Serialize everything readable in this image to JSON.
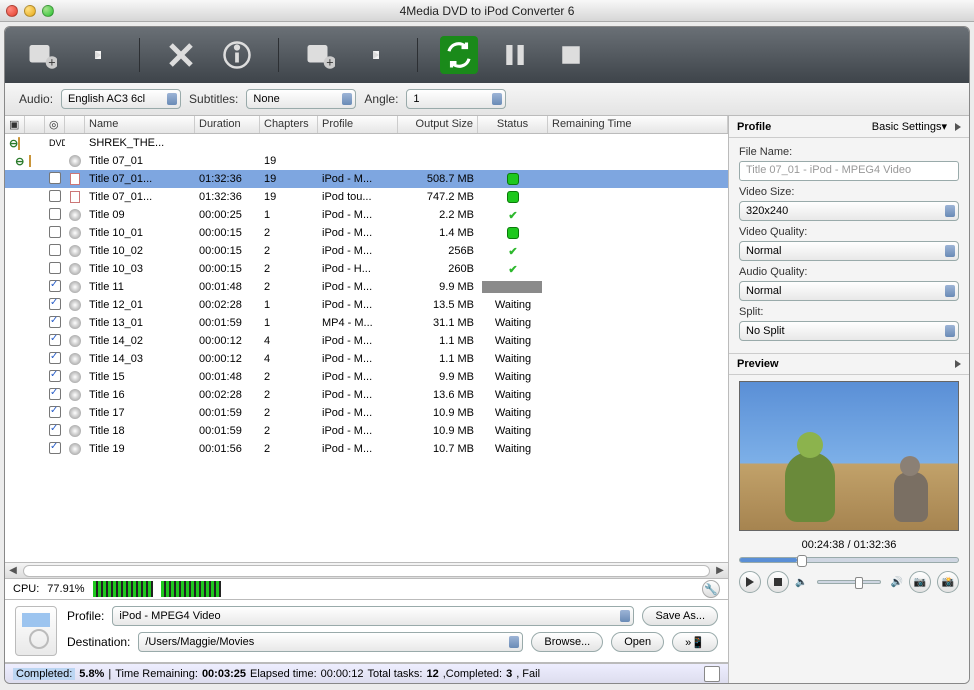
{
  "app": {
    "title": "4Media DVD to iPod Converter 6"
  },
  "selectors": {
    "audio_label": "Audio:",
    "audio_value": "English AC3 6cl",
    "subtitles_label": "Subtitles:",
    "subtitles_value": "None",
    "angle_label": "Angle:",
    "angle_value": "1"
  },
  "columns": {
    "name": "Name",
    "duration": "Duration",
    "chapters": "Chapters",
    "profile": "Profile",
    "output": "Output Size",
    "status": "Status",
    "remaining": "Remaining Time"
  },
  "rows": [
    {
      "tree": "root",
      "icon": "dvd",
      "name": "SHREK_THE...",
      "dur": "",
      "chap": "",
      "prof": "",
      "out": "",
      "stat": ""
    },
    {
      "tree": "folder",
      "icon": "disc",
      "name": "Title 07_01",
      "dur": "",
      "chap": "19",
      "prof": "",
      "out": "",
      "stat": ""
    },
    {
      "tree": "item",
      "sel": true,
      "chk": false,
      "icon": "file",
      "name": "Title 07_01...",
      "dur": "01:32:36",
      "chap": "19",
      "prof": "iPod - M...",
      "out": "508.7 MB",
      "stat": "green"
    },
    {
      "tree": "item",
      "chk": false,
      "icon": "file",
      "name": "Title 07_01...",
      "dur": "01:32:36",
      "chap": "19",
      "prof": "iPod tou...",
      "out": "747.2 MB",
      "stat": "green"
    },
    {
      "tree": "item",
      "chk": false,
      "icon": "disc",
      "name": "Title 09",
      "dur": "00:00:25",
      "chap": "1",
      "prof": "iPod - M...",
      "out": "2.2 MB",
      "stat": "check"
    },
    {
      "tree": "item",
      "chk": false,
      "icon": "disc",
      "name": "Title 10_01",
      "dur": "00:00:15",
      "chap": "2",
      "prof": "iPod - M...",
      "out": "1.4 MB",
      "stat": "green"
    },
    {
      "tree": "item",
      "chk": false,
      "icon": "disc",
      "name": "Title 10_02",
      "dur": "00:00:15",
      "chap": "2",
      "prof": "iPod - M...",
      "out": "256B",
      "stat": "check"
    },
    {
      "tree": "item",
      "chk": false,
      "icon": "disc",
      "name": "Title 10_03",
      "dur": "00:00:15",
      "chap": "2",
      "prof": "iPod - H...",
      "out": "260B",
      "stat": "check"
    },
    {
      "tree": "item",
      "chk": true,
      "icon": "disc",
      "name": "Title 11",
      "dur": "00:01:48",
      "chap": "2",
      "prof": "iPod - M...",
      "out": "9.9 MB",
      "stat": "prog"
    },
    {
      "tree": "item",
      "chk": true,
      "icon": "disc",
      "name": "Title 12_01",
      "dur": "00:02:28",
      "chap": "1",
      "prof": "iPod - M...",
      "out": "13.5 MB",
      "stat": "Waiting"
    },
    {
      "tree": "item",
      "chk": true,
      "icon": "disc",
      "name": "Title 13_01",
      "dur": "00:01:59",
      "chap": "1",
      "prof": "MP4 - M...",
      "out": "31.1 MB",
      "stat": "Waiting"
    },
    {
      "tree": "item",
      "chk": true,
      "icon": "disc",
      "name": "Title 14_02",
      "dur": "00:00:12",
      "chap": "4",
      "prof": "iPod - M...",
      "out": "1.1 MB",
      "stat": "Waiting"
    },
    {
      "tree": "item",
      "chk": true,
      "icon": "disc",
      "name": "Title 14_03",
      "dur": "00:00:12",
      "chap": "4",
      "prof": "iPod - M...",
      "out": "1.1 MB",
      "stat": "Waiting"
    },
    {
      "tree": "item",
      "chk": true,
      "icon": "disc",
      "name": "Title 15",
      "dur": "00:01:48",
      "chap": "2",
      "prof": "iPod - M...",
      "out": "9.9 MB",
      "stat": "Waiting"
    },
    {
      "tree": "item",
      "chk": true,
      "icon": "disc",
      "name": "Title 16",
      "dur": "00:02:28",
      "chap": "2",
      "prof": "iPod - M...",
      "out": "13.6 MB",
      "stat": "Waiting"
    },
    {
      "tree": "item",
      "chk": true,
      "icon": "disc",
      "name": "Title 17",
      "dur": "00:01:59",
      "chap": "2",
      "prof": "iPod - M...",
      "out": "10.9 MB",
      "stat": "Waiting"
    },
    {
      "tree": "item",
      "chk": true,
      "icon": "disc",
      "name": "Title 18",
      "dur": "00:01:59",
      "chap": "2",
      "prof": "iPod - M...",
      "out": "10.9 MB",
      "stat": "Waiting"
    },
    {
      "tree": "item",
      "chk": true,
      "icon": "disc",
      "name": "Title 19",
      "dur": "00:01:56",
      "chap": "2",
      "prof": "iPod - M...",
      "out": "10.7 MB",
      "stat": "Waiting"
    }
  ],
  "cpu": {
    "label": "CPU:",
    "value": "77.91%"
  },
  "bottom": {
    "profile_label": "Profile:",
    "profile_value": "iPod - MPEG4 Video",
    "saveas": "Save As...",
    "destination_label": "Destination:",
    "destination_value": "/Users/Maggie/Movies",
    "browse": "Browse...",
    "open": "Open"
  },
  "status": {
    "completed_label": "Completed:",
    "completed_value": "5.8%",
    "remaining_label": "Time Remaining:",
    "remaining_value": "00:03:25",
    "elapsed_label": "Elapsed time:",
    "elapsed_value": "00:00:12",
    "tasks_label": "Total tasks:",
    "tasks_value": "12",
    "done_label": ",Completed:",
    "done_value": "3",
    "tail": ", Fail"
  },
  "panel": {
    "profile": "Profile",
    "basic": "Basic Settings",
    "filename_label": "File Name:",
    "filename_value": "Title 07_01 - iPod - MPEG4 Video",
    "videosize_label": "Video Size:",
    "videosize_value": "320x240",
    "videoq_label": "Video Quality:",
    "videoq_value": "Normal",
    "audioq_label": "Audio Quality:",
    "audioq_value": "Normal",
    "split_label": "Split:",
    "split_value": "No Split",
    "preview": "Preview",
    "timecode": "00:24:38 / 01:32:36"
  }
}
